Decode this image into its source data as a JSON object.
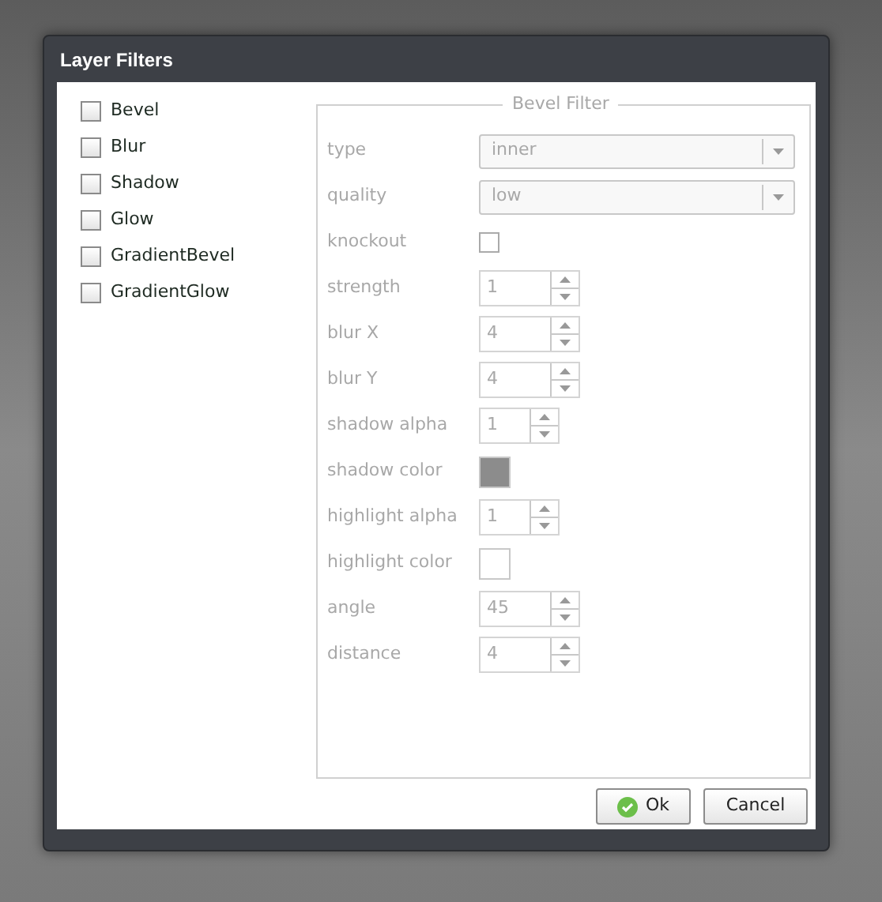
{
  "window": {
    "title": "Layer Filters"
  },
  "filters": [
    {
      "label": "Bevel",
      "checked": false
    },
    {
      "label": "Blur",
      "checked": false
    },
    {
      "label": "Shadow",
      "checked": false
    },
    {
      "label": "Glow",
      "checked": false
    },
    {
      "label": "GradientBevel",
      "checked": false
    },
    {
      "label": "GradientGlow",
      "checked": false
    }
  ],
  "panel": {
    "title": "Bevel Filter",
    "disabled": true,
    "fields": [
      {
        "label": "type",
        "kind": "select",
        "value": "inner"
      },
      {
        "label": "quality",
        "kind": "select",
        "value": "low"
      },
      {
        "label": "knockout",
        "kind": "checkbox",
        "checked": false
      },
      {
        "label": "strength",
        "kind": "spinner",
        "value": "1"
      },
      {
        "label": "blur X",
        "kind": "spinner",
        "value": "4"
      },
      {
        "label": "blur Y",
        "kind": "spinner",
        "value": "4"
      },
      {
        "label": "shadow alpha",
        "kind": "small_spinner",
        "value": "1"
      },
      {
        "label": "shadow color",
        "kind": "color",
        "color": "#8c8c8c"
      },
      {
        "label": "highlight alpha",
        "kind": "small_spinner",
        "value": "1"
      },
      {
        "label": "highlight color",
        "kind": "color",
        "color": "#ffffff"
      },
      {
        "label": "angle",
        "kind": "spinner",
        "value": "45"
      },
      {
        "label": "distance",
        "kind": "spinner",
        "value": "4"
      }
    ]
  },
  "buttons": [
    {
      "label": "Ok",
      "kind": "ok"
    },
    {
      "label": "Cancel",
      "kind": "plain"
    }
  ]
}
